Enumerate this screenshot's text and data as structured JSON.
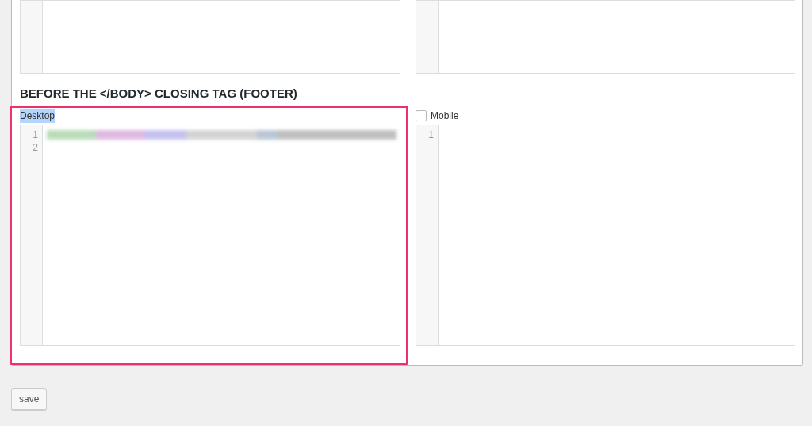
{
  "editors_above": [
    {
      "kind": "code-editor"
    },
    {
      "kind": "code-editor"
    }
  ],
  "footer_section": {
    "heading": "BEFORE THE </BODY> CLOSING TAG (FOOTER)",
    "editors": [
      {
        "kind": "plain",
        "label": "Desktop",
        "label_selected": true,
        "annotated": true,
        "lines": [
          {
            "number": "1",
            "redacted": true
          },
          {
            "number": "2",
            "redacted": false
          }
        ]
      },
      {
        "kind": "checkbox",
        "label": "Mobile",
        "checked": false,
        "label_selected": false,
        "annotated": false,
        "lines": [
          {
            "number": "1",
            "redacted": false
          }
        ]
      }
    ]
  },
  "save_button": {
    "label": "save"
  }
}
